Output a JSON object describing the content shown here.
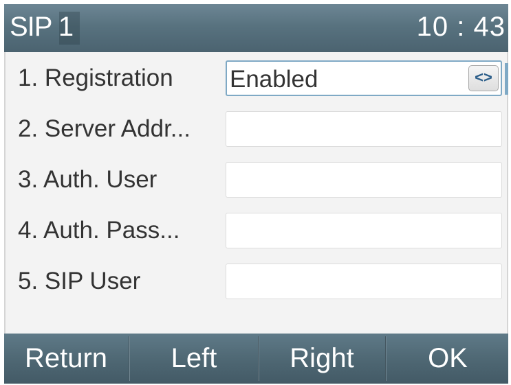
{
  "titlebar": {
    "title": "SIP 1",
    "clock": "10 : 43"
  },
  "fields": [
    {
      "label": "1.  Registration",
      "value": "Enabled",
      "selector_icon": "left-right-arrows-icon"
    },
    {
      "label": "2.  Server Addr...",
      "value": ""
    },
    {
      "label": "3.  Auth. User",
      "value": ""
    },
    {
      "label": "4.  Auth. Pass...",
      "value": ""
    },
    {
      "label": "5.  SIP User",
      "value": ""
    }
  ],
  "selector_glyph": "<>",
  "softkeys": {
    "return": "Return",
    "left": "Left",
    "right": "Right",
    "ok": "OK"
  },
  "colors": {
    "titlebar": "#58727f",
    "softkey_bar": "#4f6874",
    "selected_border": "#7fa9c5",
    "background": "#f3f3f3"
  }
}
